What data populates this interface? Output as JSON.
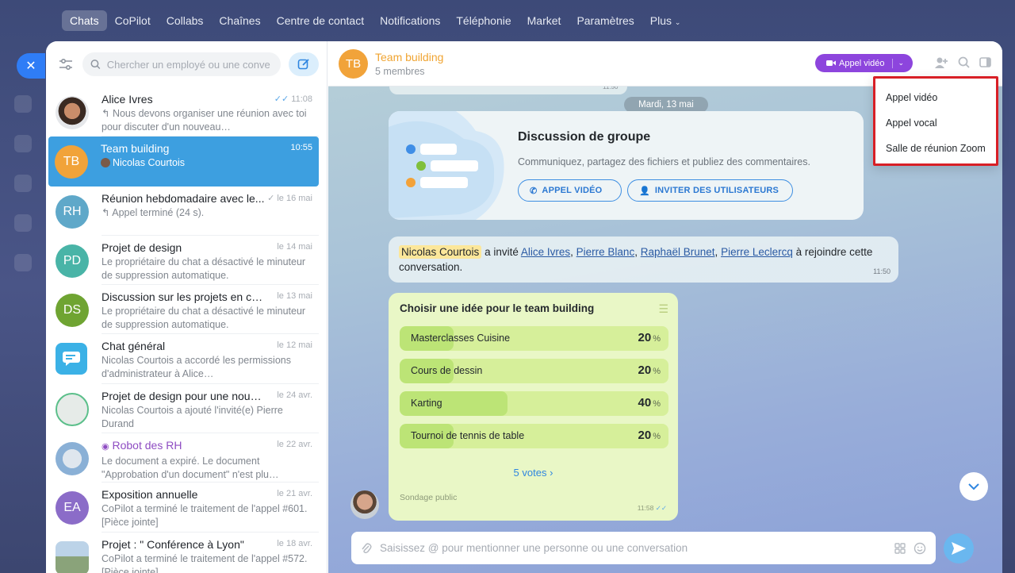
{
  "topnav": [
    "Chats",
    "CoPilot",
    "Collabs",
    "Chaînes",
    "Centre de contact",
    "Notifications",
    "Téléphonie",
    "Market",
    "Paramètres",
    "Plus"
  ],
  "search": {
    "placeholder": "Chercher un employé ou une conve"
  },
  "chats": [
    {
      "title": "Alice Ivres",
      "date": "11:08",
      "message": "↰ Nous devons organiser une réunion avec toi pour discuter d'un nouveau…",
      "avatar": "",
      "color": "#c99a78"
    },
    {
      "title": "Team building",
      "date": "10:55",
      "message": "Nicolas Courtois",
      "avatar": "TB",
      "color": "#f1a33a"
    },
    {
      "title": "Réunion hebdomadaire avec le...",
      "date": "le 16 mai",
      "message": "↰ Appel terminé (24 s).",
      "avatar": "RH",
      "color": "#5fa8c9"
    },
    {
      "title": "Projet de design",
      "date": "le 14 mai",
      "message": "Le propriétaire du chat a désactivé le minuteur de suppression automatique.",
      "avatar": "PD",
      "color": "#49b4a7"
    },
    {
      "title": "Discussion sur les projets en cours",
      "date": "le 13 mai",
      "message": "Le propriétaire du chat a désactivé le minuteur de suppression automatique.",
      "avatar": "DS",
      "color": "#6fa432"
    },
    {
      "title": "Chat général",
      "date": "le 12 mai",
      "message": "Nicolas Courtois a accordé les permissions d'administrateur à Alice…",
      "avatar": "",
      "color": "#3bb1e6"
    },
    {
      "title": "Projet de design pour une nouvel...",
      "date": "le 24 avr.",
      "message": "Nicolas Courtois a ajouté l'invité(e) Pierre Durand",
      "avatar": "",
      "color": "#e6ebe8"
    },
    {
      "title": "Robot des RH",
      "date": "le 22 avr.",
      "message": "Le document a expiré. Le document \"Approbation d'un document\" n'est plu…",
      "avatar": "",
      "color": "#8ab0d6"
    },
    {
      "title": "Exposition annuelle",
      "date": "le 21 avr.",
      "message": "CoPilot a terminé le traitement de l'appel #601. [Pièce jointe]",
      "avatar": "EA",
      "color": "#8b6cc8"
    },
    {
      "title": "Projet : \" Conférence à Lyon\"",
      "date": "le 18 avr.",
      "message": "CoPilot a terminé le traitement de l'appel #572. [Pièce jointe]",
      "avatar": "",
      "color": "#8aa37a"
    }
  ],
  "header": {
    "avatar": "TB",
    "title": "Team building",
    "subtitle": "5 membres",
    "video_button": "Appel vidéo"
  },
  "date_pill": "Mardi, 13 mai",
  "top_time": "11:50",
  "group_card": {
    "title": "Discussion de groupe",
    "text": "Communiquez, partagez des fichiers et publiez des commentaires.",
    "btn_video": "APPEL VIDÉO",
    "btn_invite": "INVITER DES UTILISATEURS"
  },
  "system_message": {
    "actor": "Nicolas Courtois",
    "mid": "a invité",
    "invitees": [
      "Alice Ivres",
      "Pierre Blanc",
      "Raphaël Brunet",
      "Pierre Leclercq"
    ],
    "tail": "à rejoindre cette conversation.",
    "time": "11:50"
  },
  "poll": {
    "title": "Choisir une idée pour le team building",
    "options": [
      {
        "label": "Masterclasses Cuisine",
        "pct": 20
      },
      {
        "label": "Cours de dessin",
        "pct": 20
      },
      {
        "label": "Karting",
        "pct": 40
      },
      {
        "label": "Tournoi de tennis de table",
        "pct": 20
      }
    ],
    "pct_unit": "%",
    "votes": "5 votes",
    "footer": "Sondage public",
    "time": "11:58"
  },
  "composer": {
    "placeholder": "Saisissez @ pour mentionner une personne ou une conversation"
  },
  "dropdown": [
    "Appel vidéo",
    "Appel vocal",
    "Salle de réunion Zoom"
  ]
}
